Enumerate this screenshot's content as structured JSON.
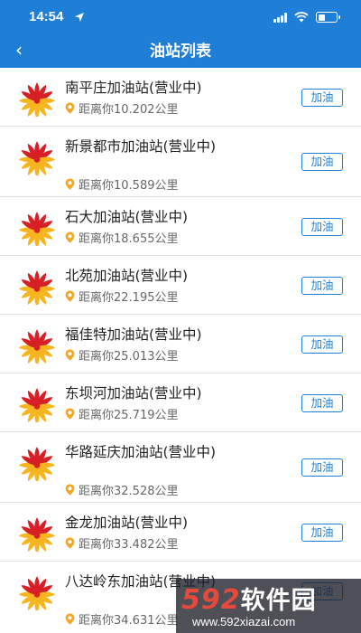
{
  "status": {
    "time": "14:54"
  },
  "nav": {
    "back_icon": "‹",
    "title": "油站列表"
  },
  "button_label": "加油",
  "stations": [
    {
      "name": "南平庄加油站(营业中)",
      "distance": "距离你10.202公里"
    },
    {
      "name": "新景都市加油站(营业中)",
      "distance": "距离你10.589公里"
    },
    {
      "name": "石大加油站(营业中)",
      "distance": "距离你18.655公里"
    },
    {
      "name": "北苑加油站(营业中)",
      "distance": "距离你22.195公里"
    },
    {
      "name": "福佳特加油站(营业中)",
      "distance": "距离你25.013公里"
    },
    {
      "name": "东坝河加油站(营业中)",
      "distance": "距离你25.719公里"
    },
    {
      "name": "华路延庆加油站(营业中)",
      "distance": "距离你32.528公里"
    },
    {
      "name": "金龙加油站(营业中)",
      "distance": "距离你33.482公里"
    },
    {
      "name": "八达岭东加油站(营业中)",
      "distance": "距离你34.631公里"
    }
  ],
  "watermark": {
    "brand_num": "592",
    "brand_cn": "软件园",
    "url": "www.592xiazai.com"
  },
  "colors": {
    "accent": "#1f7fd6",
    "logo_red": "#d71f26",
    "logo_yellow": "#f6b51e"
  }
}
